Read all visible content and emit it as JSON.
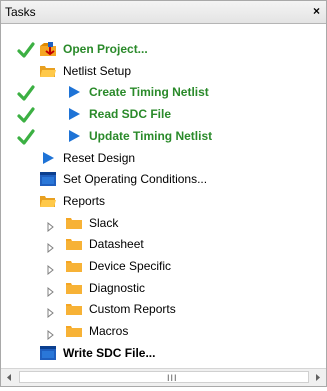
{
  "panel": {
    "title": "Tasks",
    "close_glyph": "×"
  },
  "tree": [
    {
      "label": "Open Project...",
      "icon": "open-project-icon",
      "style": "green",
      "checked": true,
      "expander": "none"
    },
    {
      "label": "Netlist Setup",
      "icon": "folder-open-icon",
      "style": "normal",
      "checked": false,
      "expander": "none"
    },
    {
      "label": "Create Timing Netlist",
      "icon": "play-arrow-icon",
      "style": "green",
      "checked": true,
      "expander": "none"
    },
    {
      "label": "Read SDC File",
      "icon": "play-arrow-icon",
      "style": "green",
      "checked": true,
      "expander": "none"
    },
    {
      "label": "Update Timing Netlist",
      "icon": "play-arrow-icon",
      "style": "green",
      "checked": true,
      "expander": "none"
    },
    {
      "label": "Reset Design",
      "icon": "play-arrow-icon",
      "style": "normal",
      "checked": false,
      "expander": "none"
    },
    {
      "label": "Set Operating Conditions...",
      "icon": "window-icon",
      "style": "normal",
      "checked": false,
      "expander": "none"
    },
    {
      "label": "Reports",
      "icon": "folder-open-icon",
      "style": "normal",
      "checked": false,
      "expander": "none"
    },
    {
      "label": "Slack",
      "icon": "folder-icon",
      "style": "normal",
      "checked": false,
      "expander": "collapsed"
    },
    {
      "label": "Datasheet",
      "icon": "folder-icon",
      "style": "normal",
      "checked": false,
      "expander": "collapsed"
    },
    {
      "label": "Device Specific",
      "icon": "folder-icon",
      "style": "normal",
      "checked": false,
      "expander": "collapsed"
    },
    {
      "label": "Diagnostic",
      "icon": "folder-icon",
      "style": "normal",
      "checked": false,
      "expander": "collapsed"
    },
    {
      "label": "Custom Reports",
      "icon": "folder-icon",
      "style": "normal",
      "checked": false,
      "expander": "collapsed"
    },
    {
      "label": "Macros",
      "icon": "folder-icon",
      "style": "normal",
      "checked": false,
      "expander": "collapsed"
    },
    {
      "label": "Write SDC File...",
      "icon": "window-icon",
      "style": "bold",
      "checked": false,
      "expander": "none"
    }
  ],
  "scrollbar": {
    "grip": "III"
  },
  "colors": {
    "check": "#3cb043",
    "arrow": "#1e73d6",
    "folder": "#f5a623",
    "green_text": "#2a8a2a"
  }
}
